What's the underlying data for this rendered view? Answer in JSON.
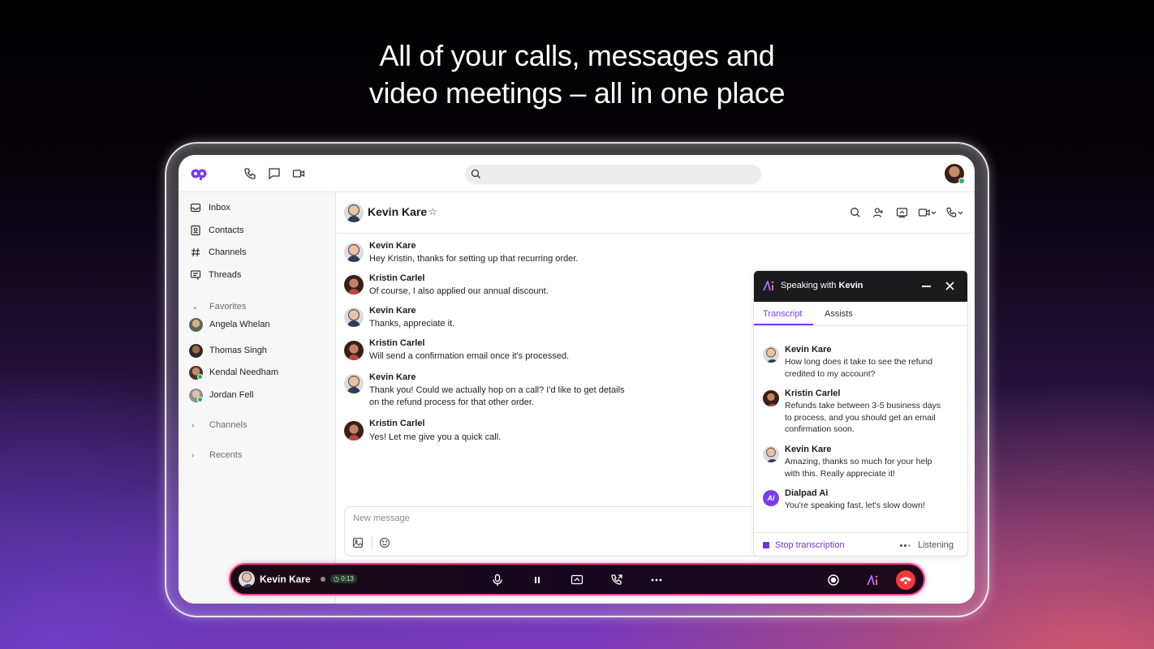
{
  "headline": {
    "line1": "All of your calls, messages and",
    "line2": "video meetings – all in one place"
  },
  "topbar": {
    "icons": [
      "dialpad-logo-icon",
      "phone-icon",
      "chat-icon",
      "video-icon",
      "search-icon"
    ],
    "search_placeholder": ""
  },
  "sidebar": {
    "items": [
      {
        "label": "Inbox",
        "icon": "inbox-icon"
      },
      {
        "label": "Contacts",
        "icon": "contacts-icon"
      },
      {
        "label": "Channels",
        "icon": "hash-icon"
      },
      {
        "label": "Threads",
        "icon": "threads-icon"
      }
    ],
    "favorites_label": "Favorites",
    "favorites": [
      {
        "name": "Angela Whelan",
        "online": false
      },
      {
        "name": "Thomas Singh",
        "online": false
      },
      {
        "name": "Kendal Needham",
        "online": true
      },
      {
        "name": "Jordan Fell",
        "online": true
      }
    ],
    "channels_label": "Channels",
    "recents_label": "Recents"
  },
  "conversation": {
    "contact_name": "Kevin Kare",
    "star": "☆",
    "messages": [
      {
        "author": "Kevin Kare",
        "lines": [
          "Hey Kristin, thanks for setting up that recurring order."
        ]
      },
      {
        "author": "Kristin Carlel",
        "lines": [
          "Of course, I also applied our annual discount."
        ]
      },
      {
        "author": "Kevin Kare",
        "lines": [
          "Thanks, appreciate it."
        ]
      },
      {
        "author": "Kristin Carlel",
        "lines": [
          "Will send a confirmation email once it's processed."
        ]
      },
      {
        "author": "Kevin Kare",
        "lines": [
          "Thank you! Could we actually hop on a call? I'd like to get details",
          "on the refund process for that other order."
        ]
      },
      {
        "author": "Kristin Carlel",
        "lines": [
          "Yes! Let me give you a quick call."
        ]
      }
    ],
    "composer_placeholder": "New message"
  },
  "ai_panel": {
    "title_prefix": "Speaking with ",
    "title_name": "Kevin",
    "tabs": [
      "Transcript",
      "Assists"
    ],
    "transcript": [
      {
        "author": "Kevin Kare",
        "lines": [
          "How long does it take to see the refund",
          "credited to my account?"
        ]
      },
      {
        "author": "Kristin Carlel",
        "lines": [
          "Refunds take between 3-5 business days",
          "to process, and you should get an email",
          "confirmation soon."
        ]
      },
      {
        "author": "Kevin Kare",
        "lines": [
          "Amazing, thanks so much for your help",
          "with this. Really appreciate it!"
        ]
      },
      {
        "author": "Dialpad Ai",
        "lines": [
          "You're speaking fast, let's slow down!"
        ]
      }
    ],
    "stop_label": "Stop transcription",
    "status_label": "Listening"
  },
  "callbar": {
    "name": "Kevin Kare",
    "timer": "0:13"
  },
  "colors": {
    "accent": "#7a3cf2",
    "hangup": "#f2393a",
    "callbar_border": "#ff3d8b",
    "online": "#1fb45c"
  }
}
